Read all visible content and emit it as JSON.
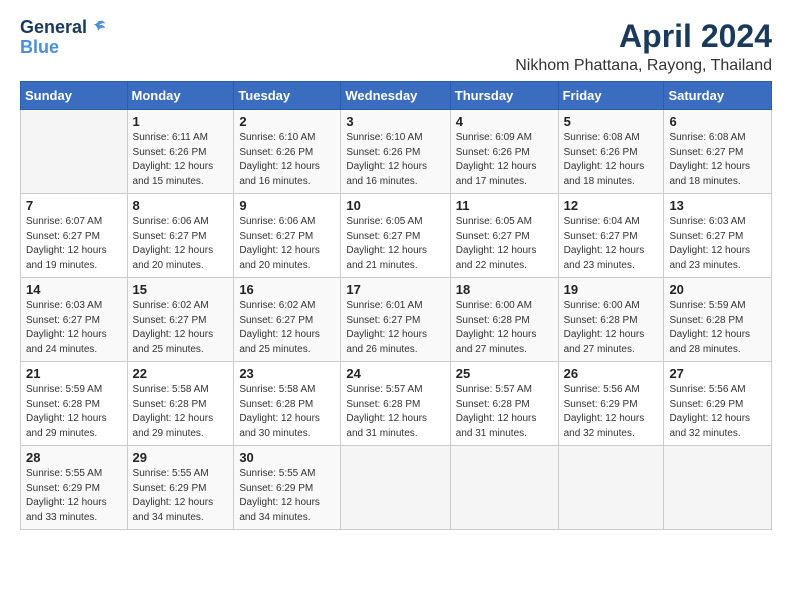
{
  "header": {
    "logo_line1": "General",
    "logo_line2": "Blue",
    "title": "April 2024",
    "subtitle": "Nikhom Phattana, Rayong, Thailand"
  },
  "weekdays": [
    "Sunday",
    "Monday",
    "Tuesday",
    "Wednesday",
    "Thursday",
    "Friday",
    "Saturday"
  ],
  "weeks": [
    [
      {
        "day": "",
        "info": ""
      },
      {
        "day": "1",
        "info": "Sunrise: 6:11 AM\nSunset: 6:26 PM\nDaylight: 12 hours\nand 15 minutes."
      },
      {
        "day": "2",
        "info": "Sunrise: 6:10 AM\nSunset: 6:26 PM\nDaylight: 12 hours\nand 16 minutes."
      },
      {
        "day": "3",
        "info": "Sunrise: 6:10 AM\nSunset: 6:26 PM\nDaylight: 12 hours\nand 16 minutes."
      },
      {
        "day": "4",
        "info": "Sunrise: 6:09 AM\nSunset: 6:26 PM\nDaylight: 12 hours\nand 17 minutes."
      },
      {
        "day": "5",
        "info": "Sunrise: 6:08 AM\nSunset: 6:26 PM\nDaylight: 12 hours\nand 18 minutes."
      },
      {
        "day": "6",
        "info": "Sunrise: 6:08 AM\nSunset: 6:27 PM\nDaylight: 12 hours\nand 18 minutes."
      }
    ],
    [
      {
        "day": "7",
        "info": "Sunrise: 6:07 AM\nSunset: 6:27 PM\nDaylight: 12 hours\nand 19 minutes."
      },
      {
        "day": "8",
        "info": "Sunrise: 6:06 AM\nSunset: 6:27 PM\nDaylight: 12 hours\nand 20 minutes."
      },
      {
        "day": "9",
        "info": "Sunrise: 6:06 AM\nSunset: 6:27 PM\nDaylight: 12 hours\nand 20 minutes."
      },
      {
        "day": "10",
        "info": "Sunrise: 6:05 AM\nSunset: 6:27 PM\nDaylight: 12 hours\nand 21 minutes."
      },
      {
        "day": "11",
        "info": "Sunrise: 6:05 AM\nSunset: 6:27 PM\nDaylight: 12 hours\nand 22 minutes."
      },
      {
        "day": "12",
        "info": "Sunrise: 6:04 AM\nSunset: 6:27 PM\nDaylight: 12 hours\nand 23 minutes."
      },
      {
        "day": "13",
        "info": "Sunrise: 6:03 AM\nSunset: 6:27 PM\nDaylight: 12 hours\nand 23 minutes."
      }
    ],
    [
      {
        "day": "14",
        "info": "Sunrise: 6:03 AM\nSunset: 6:27 PM\nDaylight: 12 hours\nand 24 minutes."
      },
      {
        "day": "15",
        "info": "Sunrise: 6:02 AM\nSunset: 6:27 PM\nDaylight: 12 hours\nand 25 minutes."
      },
      {
        "day": "16",
        "info": "Sunrise: 6:02 AM\nSunset: 6:27 PM\nDaylight: 12 hours\nand 25 minutes."
      },
      {
        "day": "17",
        "info": "Sunrise: 6:01 AM\nSunset: 6:27 PM\nDaylight: 12 hours\nand 26 minutes."
      },
      {
        "day": "18",
        "info": "Sunrise: 6:00 AM\nSunset: 6:28 PM\nDaylight: 12 hours\nand 27 minutes."
      },
      {
        "day": "19",
        "info": "Sunrise: 6:00 AM\nSunset: 6:28 PM\nDaylight: 12 hours\nand 27 minutes."
      },
      {
        "day": "20",
        "info": "Sunrise: 5:59 AM\nSunset: 6:28 PM\nDaylight: 12 hours\nand 28 minutes."
      }
    ],
    [
      {
        "day": "21",
        "info": "Sunrise: 5:59 AM\nSunset: 6:28 PM\nDaylight: 12 hours\nand 29 minutes."
      },
      {
        "day": "22",
        "info": "Sunrise: 5:58 AM\nSunset: 6:28 PM\nDaylight: 12 hours\nand 29 minutes."
      },
      {
        "day": "23",
        "info": "Sunrise: 5:58 AM\nSunset: 6:28 PM\nDaylight: 12 hours\nand 30 minutes."
      },
      {
        "day": "24",
        "info": "Sunrise: 5:57 AM\nSunset: 6:28 PM\nDaylight: 12 hours\nand 31 minutes."
      },
      {
        "day": "25",
        "info": "Sunrise: 5:57 AM\nSunset: 6:28 PM\nDaylight: 12 hours\nand 31 minutes."
      },
      {
        "day": "26",
        "info": "Sunrise: 5:56 AM\nSunset: 6:29 PM\nDaylight: 12 hours\nand 32 minutes."
      },
      {
        "day": "27",
        "info": "Sunrise: 5:56 AM\nSunset: 6:29 PM\nDaylight: 12 hours\nand 32 minutes."
      }
    ],
    [
      {
        "day": "28",
        "info": "Sunrise: 5:55 AM\nSunset: 6:29 PM\nDaylight: 12 hours\nand 33 minutes."
      },
      {
        "day": "29",
        "info": "Sunrise: 5:55 AM\nSunset: 6:29 PM\nDaylight: 12 hours\nand 34 minutes."
      },
      {
        "day": "30",
        "info": "Sunrise: 5:55 AM\nSunset: 6:29 PM\nDaylight: 12 hours\nand 34 minutes."
      },
      {
        "day": "",
        "info": ""
      },
      {
        "day": "",
        "info": ""
      },
      {
        "day": "",
        "info": ""
      },
      {
        "day": "",
        "info": ""
      }
    ]
  ]
}
